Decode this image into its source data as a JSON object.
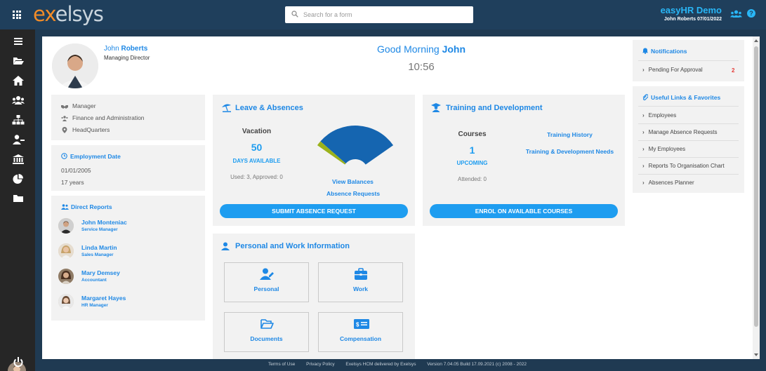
{
  "topbar": {
    "logo_prefix": "ex",
    "logo_rest": "elsys",
    "search_placeholder": "Search for a form",
    "app_title": "easyHR Demo",
    "user_date": "John Roberts 07/01/2022"
  },
  "sidebar": {
    "icons": [
      "menu-icon",
      "folder-open-icon",
      "home-icon",
      "team-icon",
      "org-chart-icon",
      "user-minus-icon",
      "bank-icon",
      "pie-chart-icon",
      "folder-icon",
      "avatar",
      "power-icon"
    ]
  },
  "profile": {
    "first_name": "John",
    "last_name": "Roberts",
    "title": "Managing Director",
    "greeting_prefix": "Good Morning",
    "greeting_name": "John",
    "time": "10:56"
  },
  "details": {
    "role": "Manager",
    "department": "Finance and Administration",
    "location": "HeadQuarters"
  },
  "employment": {
    "heading": "Employment Date",
    "date": "01/01/2005",
    "years": "17 years"
  },
  "direct_reports": {
    "heading": "Direct Reports",
    "people": [
      {
        "name": "John Monteniac",
        "role": "Service Manager"
      },
      {
        "name": "Linda Martin",
        "role": "Sales Manager"
      },
      {
        "name": "Mary Demsey",
        "role": "Accountant"
      },
      {
        "name": "Margaret Hayes",
        "role": "HR Manager"
      }
    ]
  },
  "leave": {
    "title": "Leave & Absences",
    "type": "Vacation",
    "days": "50",
    "days_label": "DAYS AVAILABLE",
    "used_text": "Used: 3, Approved: 0",
    "view_balances": "View Balances",
    "absence_requests": "Absence Requests",
    "submit_button": "SUBMIT ABSENCE REQUEST",
    "gauge": {
      "total": 53,
      "used": 3,
      "approved": 0,
      "available": 50,
      "used_color": "#9bb21b",
      "available_color": "#1565b0"
    }
  },
  "training": {
    "title": "Training and Development",
    "courses_label": "Courses",
    "count": "1",
    "upcoming_label": "UPCOMING",
    "attended_text": "Attended: 0",
    "history_link": "Training History",
    "needs_link": "Training & Development Needs",
    "enrol_button": "ENROL ON AVAILABLE COURSES"
  },
  "personal_work": {
    "title": "Personal and Work Information",
    "tiles": [
      "Personal",
      "Work",
      "Documents",
      "Compensation"
    ]
  },
  "notifications": {
    "heading": "Notifications",
    "item_label": "Pending For Approval",
    "item_count": "2"
  },
  "useful_links": {
    "heading": "Useful Links & Favorites",
    "items": [
      "Employees",
      "Manage Absence Requests",
      "My Employees",
      "Reports To Organisation Chart",
      "Absences Planner"
    ]
  },
  "footer": {
    "links": [
      "Terms of Use",
      "Privacy Policy",
      "Exelsys HCM delivered by Exelsys",
      "Version 7.04.05 Build 17.09.2021 (c) 2008 - 2022"
    ]
  },
  "colors": {
    "accent": "#1e88e5",
    "button": "#1e9df0",
    "topbar": "#1f3f5c",
    "sidebar": "#262626",
    "notification_count": "#e53935"
  }
}
